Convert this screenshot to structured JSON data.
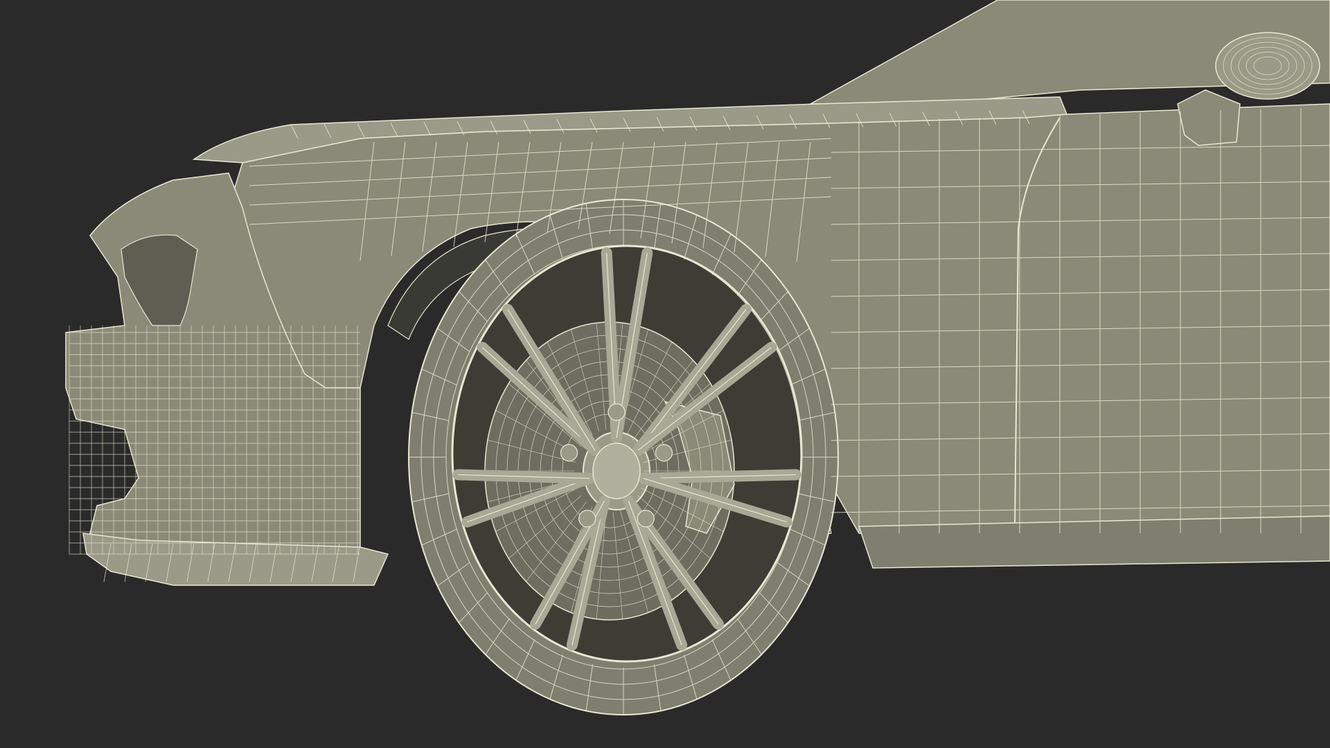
{
  "render": {
    "background_color": "#2a2a2a",
    "body_fill": "#8a8a78",
    "body_fill_light": "#9a9a88",
    "body_fill_dark": "#6e6e60",
    "tire_fill": "#7f7f70",
    "wire_color": "#e9e7d2",
    "shadow_color": "#3a3a34"
  },
  "subject": {
    "name": "car-front-wireframe",
    "parts": [
      "hood",
      "front-fender",
      "front-bumper",
      "headlight",
      "splitter",
      "wheel-arch",
      "front-wheel",
      "brake-disc",
      "side-mirror",
      "door",
      "windshield-pillar"
    ]
  }
}
